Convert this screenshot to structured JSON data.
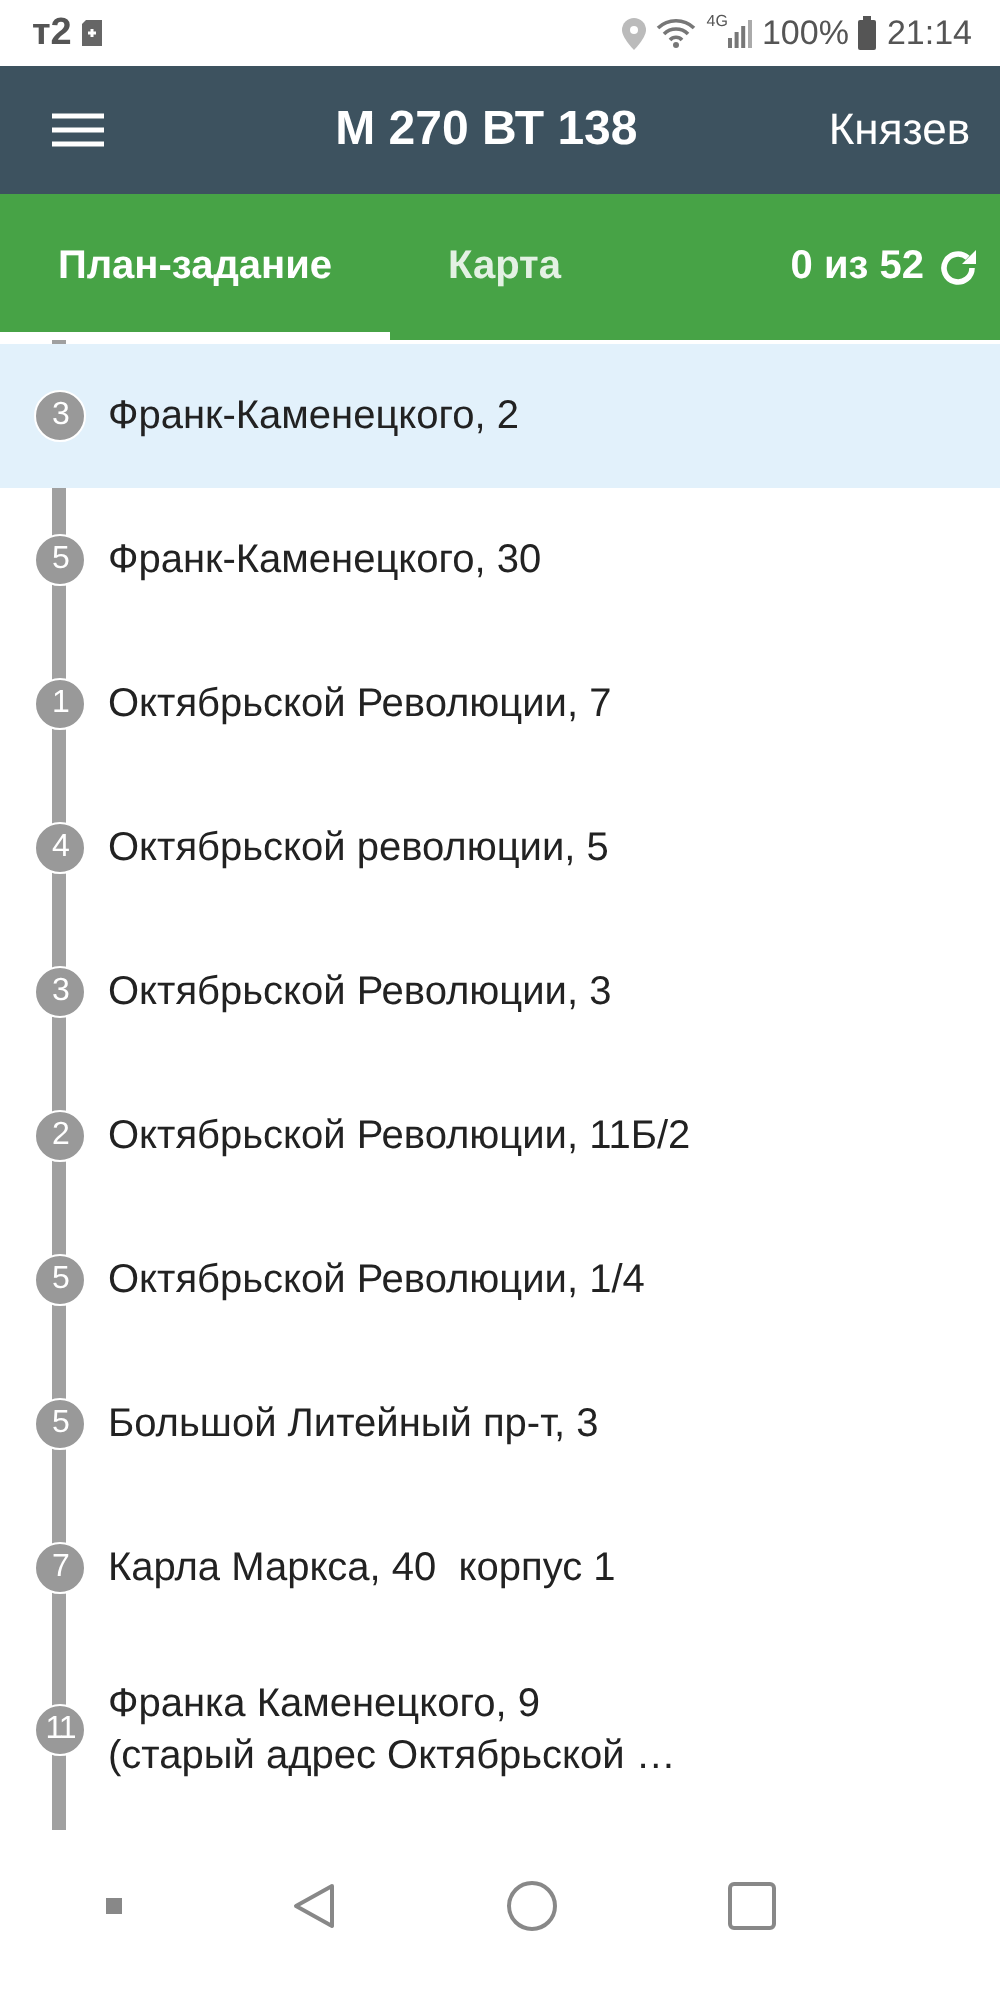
{
  "status_bar": {
    "carrier": "т2",
    "network": "4G",
    "battery": "100%",
    "time": "21:14"
  },
  "header": {
    "title": "М 270 ВТ 138",
    "user": "Князев"
  },
  "tabs": [
    {
      "label": "План-задание",
      "selected": true
    },
    {
      "label": "Карта",
      "selected": false
    }
  ],
  "counter": "0 из 52",
  "stops": [
    {
      "number": "3",
      "address": "Франк-Каменецкого, 2",
      "selected": true
    },
    {
      "number": "5",
      "address": "Франк-Каменецкого, 30",
      "selected": false
    },
    {
      "number": "1",
      "address": "Октябрьской Революции, 7",
      "selected": false
    },
    {
      "number": "4",
      "address": "Октябрьской революции, 5",
      "selected": false
    },
    {
      "number": "3",
      "address": "Октябрьской Революции, 3",
      "selected": false
    },
    {
      "number": "2",
      "address": "Октябрьской Революции, 11Б/2",
      "selected": false
    },
    {
      "number": "5",
      "address": "Октябрьской Революции, 1/4",
      "selected": false
    },
    {
      "number": "5",
      "address": "Большой Литейный пр-т, 3",
      "selected": false
    },
    {
      "number": "7",
      "address": "Карла Маркса, 40  корпус 1",
      "selected": false
    },
    {
      "number": "11",
      "address": "Франка Каменецкого, 9\n(старый адрес Октябрьской …",
      "selected": false
    }
  ]
}
